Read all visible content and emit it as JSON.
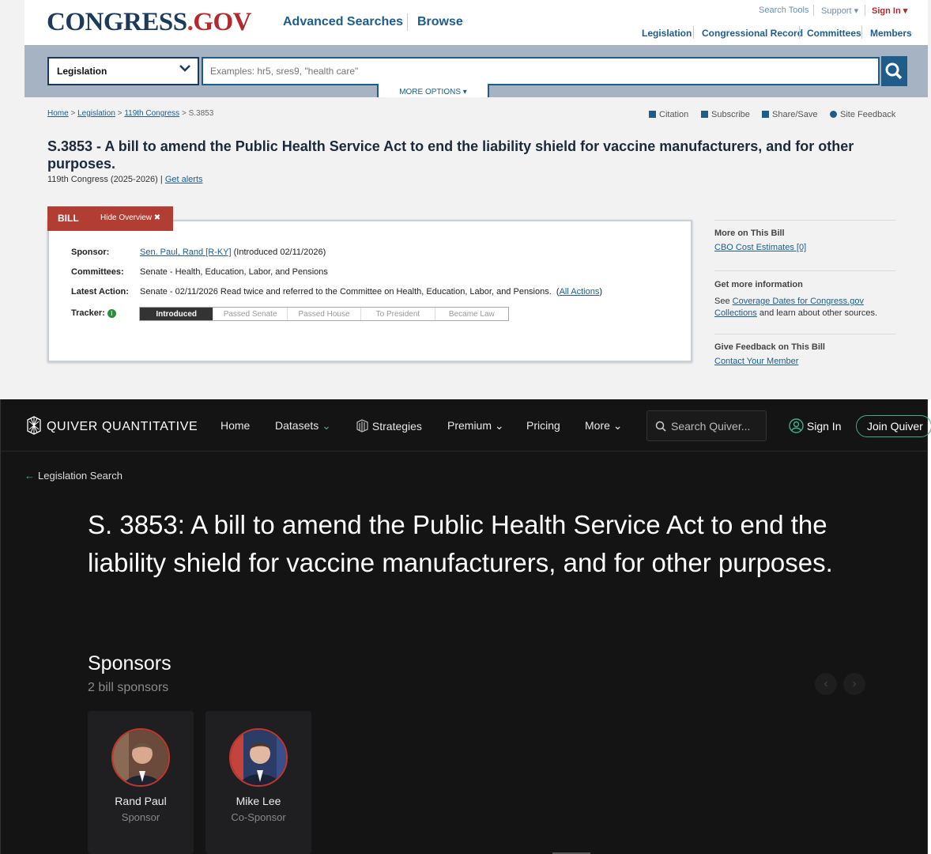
{
  "congress": {
    "logo": {
      "main": "CONGRESS",
      "dot": ".",
      "gov": "GOV"
    },
    "top_nav": [
      "Advanced Searches",
      "Browse"
    ],
    "util_nav": [
      "Search Tools",
      "Support ▾",
      "Sign In ▾"
    ],
    "sec_nav": [
      "Legislation",
      "Congressional Record",
      "Committees",
      "Members"
    ],
    "search": {
      "select_value": "Legislation",
      "placeholder": "Examples: hr5, sres9, \"health care\"",
      "more_options": "MORE OPTIONS ▾"
    },
    "breadcrumb": {
      "home": "Home",
      "legislation": "Legislation",
      "congress": "119th Congress",
      "current": "S.3853"
    },
    "tools": [
      "Citation",
      "Subscribe",
      "Share/Save",
      "Site Feedback"
    ],
    "title": "S.3853 - A bill to amend the Public Health Service Act to end the liability shield for vaccine manufacturers, and for other purposes.",
    "congress_line": "119th Congress (2025-2026) |",
    "get_alerts": "Get alerts",
    "tab": {
      "bill": "BILL",
      "hide": "Hide Overview ✖"
    },
    "overview": {
      "sponsor_label": "Sponsor:",
      "sponsor_link": "Sen. Paul, Rand [R-KY]",
      "sponsor_rest": "(Introduced 02/11/2026)",
      "committees_label": "Committees:",
      "committees_value": "Senate - Health, Education, Labor, and Pensions",
      "latest_label": "Latest Action:",
      "latest_value": "Senate - 02/11/2026 Read twice and referred to the Committee on Health, Education, Labor, and Pensions.",
      "all_actions": "All Actions",
      "tracker_label": "Tracker:",
      "tracker_steps": [
        "Introduced",
        "Passed Senate",
        "Passed House",
        "To President",
        "Became Law"
      ],
      "tracker_progress": 0.2
    },
    "sidebar": {
      "more_hd": "More on This Bill",
      "cbo": "CBO Cost Estimates [0]",
      "info_hd": "Get more information",
      "see": "See",
      "coverage": "Coverage Dates for Congress.gov Collections",
      "learn": "and learn about other sources.",
      "feedback_hd": "Give Feedback on This Bill",
      "contact": "Contact Your Member"
    }
  },
  "quiver": {
    "logo": "QUIVER QUANTITATIVE",
    "nav": [
      "Home",
      "Datasets",
      "Strategies",
      "Premium",
      "Pricing",
      "More"
    ],
    "search_placeholder": "Search Quiver...",
    "sign_in": "Sign In",
    "join": "Join Quiver",
    "back": "Legislation Search",
    "title": "S. 3853: A bill to amend the Public Health Service Act to end the liability shield for vaccine manufacturers, and for other purposes.",
    "sponsors_title": "Sponsors",
    "sponsors_sub": "2 bill sponsors",
    "sponsors": [
      {
        "name": "Rand Paul",
        "role": "Sponsor"
      },
      {
        "name": "Mike Lee",
        "role": "Co-Sponsor"
      }
    ],
    "colors": {
      "accent": "#3fae8c",
      "background": "#141414",
      "congress_red": "#b13d33",
      "congress_blue": "#1e5d8a"
    }
  }
}
